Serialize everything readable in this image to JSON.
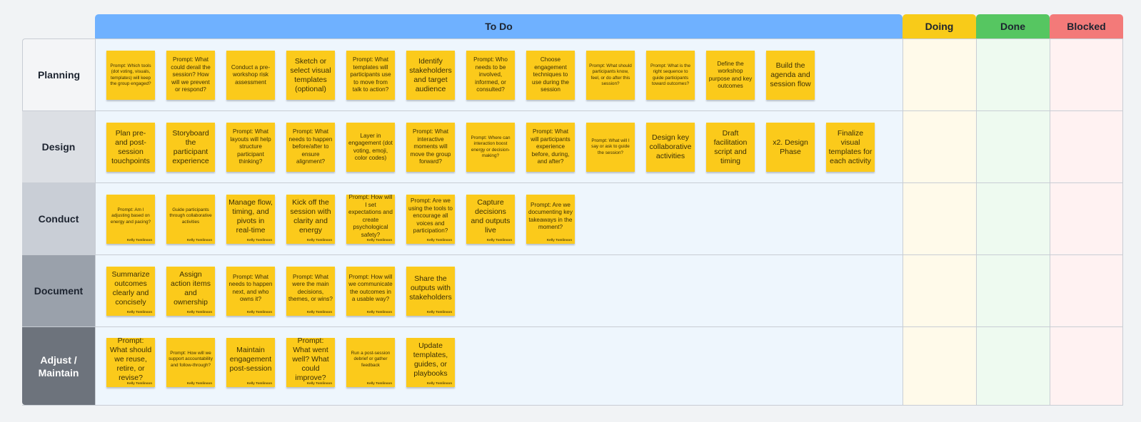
{
  "columns": {
    "todo": "To Do",
    "doing": "Doing",
    "done": "Done",
    "blocked": "Blocked"
  },
  "rows": [
    {
      "label": "Planning",
      "color": "#f4f5f7"
    },
    {
      "label": "Design",
      "color": "#dcdfe4"
    },
    {
      "label": "Conduct",
      "color": "#c9ced6"
    },
    {
      "label": "Document",
      "color": "#9aa1ab"
    },
    {
      "label": "Adjust / Maintain",
      "color": "#6d737c"
    }
  ],
  "colors": {
    "todo_header": "#6fb1ff",
    "doing_header": "#f8cb19",
    "done_header": "#56c661",
    "blocked_header": "#f37a79",
    "sticky": "#fbca1b"
  },
  "stickies": {
    "planning": [
      "Prompt: Which tools (dot voting, visuals, templates) will keep the group engaged?",
      "Prompt: What could derail the session? How will we prevent or respond?",
      "Conduct a pre-workshop risk assessment",
      "Sketch or select visual templates (optional)",
      "Prompt: What templates will participants use to move from talk to action?",
      "Identify stakeholders and target audience",
      "Prompt: Who needs to be involved, informed, or consulted?",
      "Choose engagement techniques to use during the session",
      "Prompt: What should participants know, feel, or do after this session?",
      "Prompt: What is the right sequence to guide participants toward outcomes?",
      "Define the workshop purpose and key outcomes",
      "Build the agenda and session flow"
    ],
    "design": [
      "Plan pre- and post-session touchpoints",
      "Storyboard the participant experience",
      "Prompt: What layouts will help structure participant thinking?",
      "Prompt: What needs to happen before/after to ensure alignment?",
      "Layer in engagement (dot voting, emoji, color codes)",
      "Prompt: What interactive moments will move the group forward?",
      "Prompt: Where can interaction boost energy or decision-making?",
      "Prompt: What will participants experience before, during, and after?",
      "Prompt: What will I say or ask to guide the session?",
      "Design key collaborative activities",
      "Draft facilitation script and timing",
      "x2. Design Phase",
      "Finalize visual templates for each activity"
    ],
    "conduct": [
      "Prompt: Am I adjusting based on energy and pacing?",
      "Guide participants through collaborative activities",
      "Manage flow, timing, and pivots in real-time",
      "Kick off the session with clarity and energy",
      "Prompt: How will I set expectations and create psychological safety?",
      "Prompt: Are we using the tools to encourage all voices and participation?",
      "Capture decisions and outputs live",
      "Prompt: Are we documenting key takeaways in the moment?"
    ],
    "document": [
      "Summarize outcomes clearly and concisely",
      "Assign action items and ownership",
      "Prompt: What needs to happen next, and who owns it?",
      "Prompt: What were the main decisions, themes, or wins?",
      "Prompt: How will we communicate the outcomes in a usable way?",
      "Share the outputs with stakeholders"
    ],
    "adjust": [
      "Prompt: What should we reuse, retire, or revise?",
      "Prompt: How will we support accountability and follow-through?",
      "Maintain engagement post-session",
      "Prompt: What went well? What could improve?",
      "Run a post-session debrief or gather feedback",
      "Update templates, guides, or playbooks"
    ]
  },
  "author": "Kelly Tomlinson"
}
